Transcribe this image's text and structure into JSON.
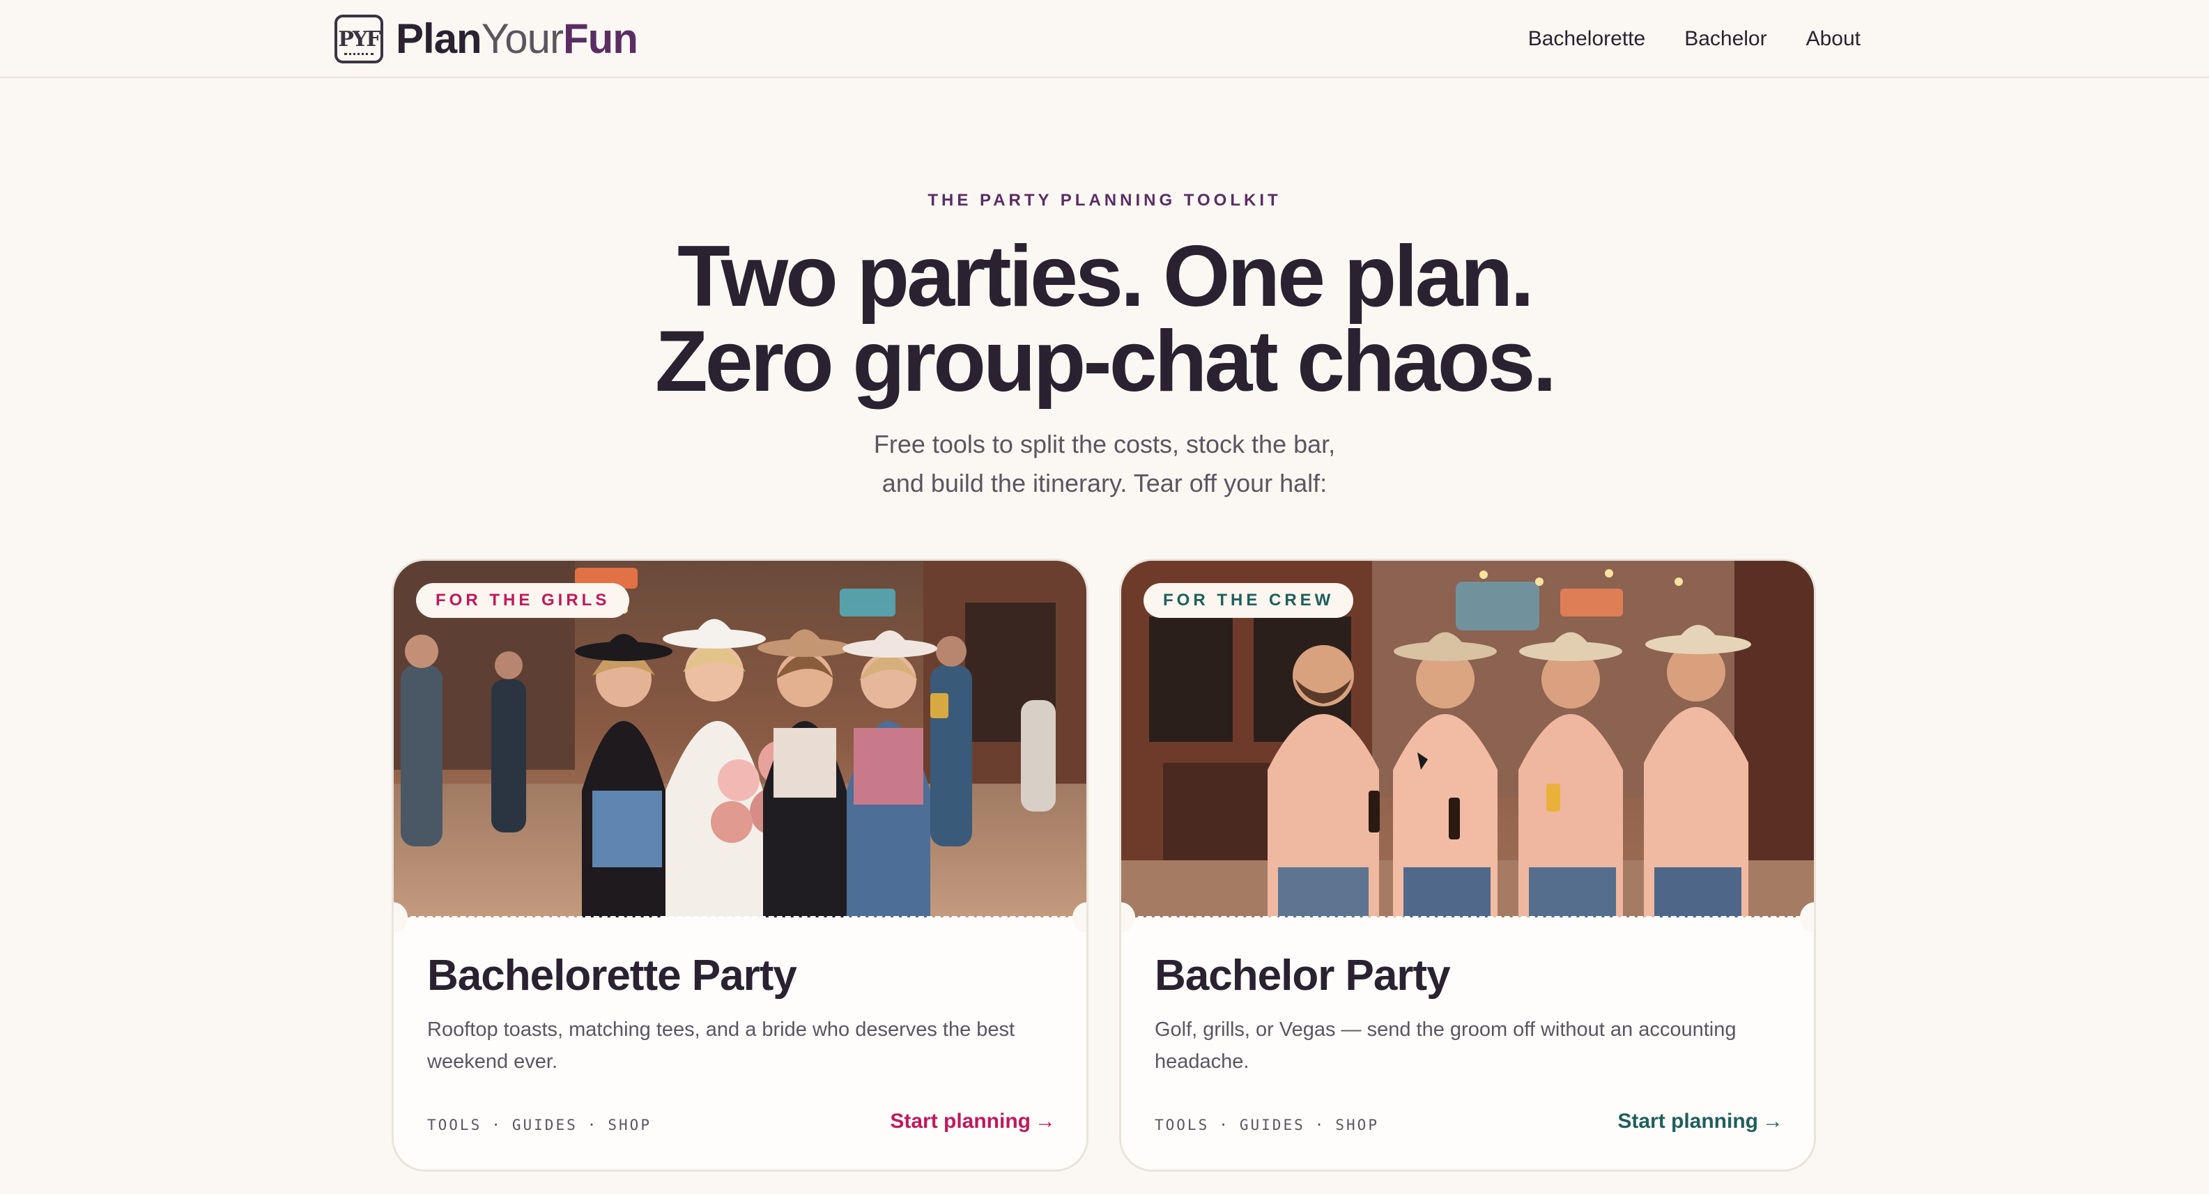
{
  "brand": {
    "badge": "PYF",
    "name_part1": "Plan",
    "name_part2": "Your",
    "name_part3": "Fun"
  },
  "nav": {
    "items": [
      {
        "label": "Bachelorette"
      },
      {
        "label": "Bachelor"
      },
      {
        "label": "About"
      }
    ]
  },
  "hero": {
    "eyebrow": "THE PARTY PLANNING TOOLKIT",
    "headline_line1": "Two parties. One plan.",
    "headline_line2": "Zero group-chat chaos.",
    "subline_line1": "Free tools to split the costs, stock the bar,",
    "subline_line2": "and build the itinerary. Tear off your half:"
  },
  "cards": [
    {
      "tag": "FOR THE GIRLS",
      "title": "Bachelorette Party",
      "description": "Rooftop toasts, matching tees, and a bride who deserves the best weekend ever.",
      "links": [
        "TOOLS",
        "GUIDES",
        "SHOP"
      ],
      "separator": "·",
      "cta": "Start planning",
      "cta_arrow": "→",
      "accent": "#c2185b"
    },
    {
      "tag": "FOR THE CREW",
      "title": "Bachelor Party",
      "description": "Golf, grills, or Vegas — send the groom off without an accounting headache.",
      "links": [
        "TOOLS",
        "GUIDES",
        "SHOP"
      ],
      "separator": "·",
      "cta": "Start planning",
      "cta_arrow": "→",
      "accent": "#1f5f5b"
    }
  ],
  "colors": {
    "background": "#fbf8f3",
    "brand_purple": "#5a2d63",
    "text_dark": "#2a2230",
    "text_muted": "#5b5560"
  }
}
